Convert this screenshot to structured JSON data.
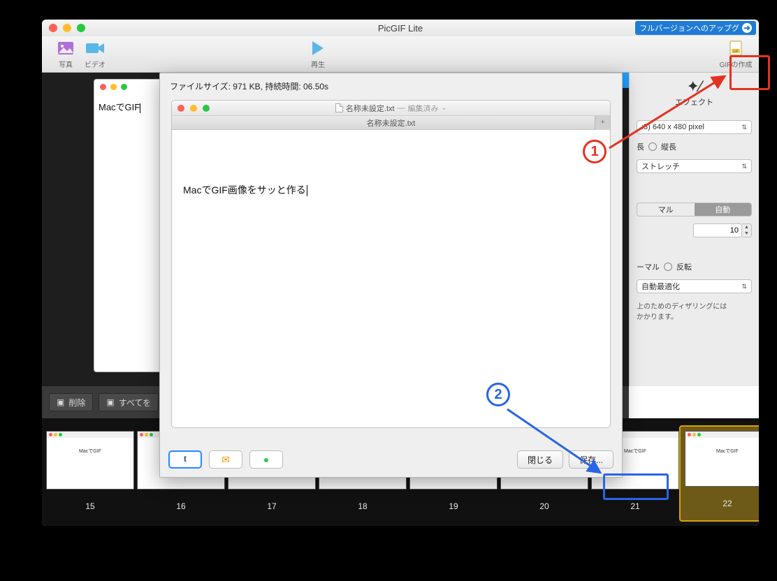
{
  "window": {
    "title": "PicGIF Lite",
    "upgrade": "フルバージョンへのアップグ"
  },
  "toolbar": {
    "photo": "写真",
    "video": "ビデオ",
    "play": "再生",
    "make_gif": "GIFの作成"
  },
  "left_preview_text": "MacでGIF",
  "sidebar": {
    "effect": "エフェクト",
    "size_preset": ":3) 640 x 480 pixel",
    "orient_long": "長",
    "orient_tall": "縦長",
    "stretch": "ストレッチ",
    "seg_normal": "マル",
    "seg_auto": "自動",
    "num_value": "10",
    "radio_normal": "ーマル",
    "radio_flip": "反転",
    "auto_opt": "自動最適化",
    "dither_note1": "上のためのディザリングには",
    "dither_note2": "かかります。"
  },
  "action_bar": {
    "delete": "削除",
    "select_all": "すべてを"
  },
  "frames": [
    "15",
    "16",
    "17",
    "18",
    "19",
    "20",
    "21",
    "22"
  ],
  "frame_thumb_text": "MacでGIF",
  "sheet": {
    "info": "ファイルサイズ: 971 KB,  持続時間: 06.50s",
    "doc_name": "名称未設定.txt",
    "doc_status": "編集済み",
    "tab_name": "名称未設定.txt",
    "body_text": "MacでGIF画像をサッと作る",
    "close": "閉じる",
    "save": "保存...",
    "share_t": "t",
    "share_mail": "✉︎",
    "share_msg": "●"
  },
  "annotations": {
    "step1": "1",
    "step2": "2"
  }
}
